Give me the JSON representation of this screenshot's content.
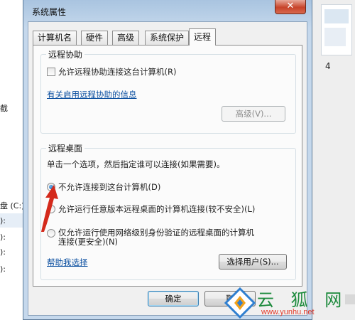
{
  "window": {
    "title": "系统属性",
    "close_glyph": "✕"
  },
  "tabs": [
    {
      "label": "计算机名"
    },
    {
      "label": "硬件"
    },
    {
      "label": "高级"
    },
    {
      "label": "系统保护"
    },
    {
      "label": "远程",
      "active": true
    }
  ],
  "remote_assistance": {
    "legend": "远程协助",
    "allow_checkbox_label": "允许远程协助连接这台计算机(R)",
    "allow_checked": false,
    "info_link": "有关启用远程协助的信息",
    "advanced_button": "高级(V)..."
  },
  "remote_desktop": {
    "legend": "远程桌面",
    "description": "单击一个选项，然后指定谁可以连接(如果需要)。",
    "options": [
      {
        "label": "不允许连接到这台计算机(D)",
        "checked": true
      },
      {
        "label": "允许运行任意版本远程桌面的计算机连接(较不安全)(L)",
        "checked": false
      },
      {
        "label": "仅允许运行使用网络级别身份验证的远程桌面的计算机连接(更安全)(N)",
        "checked": false
      }
    ],
    "help_link": "帮助我选择",
    "select_users_button": "选择用户(S)..."
  },
  "footer": {
    "ok_button": "确定",
    "cancel_button_partial": "取"
  },
  "background": {
    "left_fragments": [
      "截",
      "盘 (C:)",
      "):",
      "):",
      "):",
      "):"
    ],
    "right_number": "4"
  },
  "watermark": {
    "text": "云 狐 网",
    "url": "www.yunhu.net"
  },
  "colors": {
    "annotation_arrow": "#d42a1c",
    "watermark_green": "#1c8a3c",
    "watermark_red": "#e33a2a"
  }
}
